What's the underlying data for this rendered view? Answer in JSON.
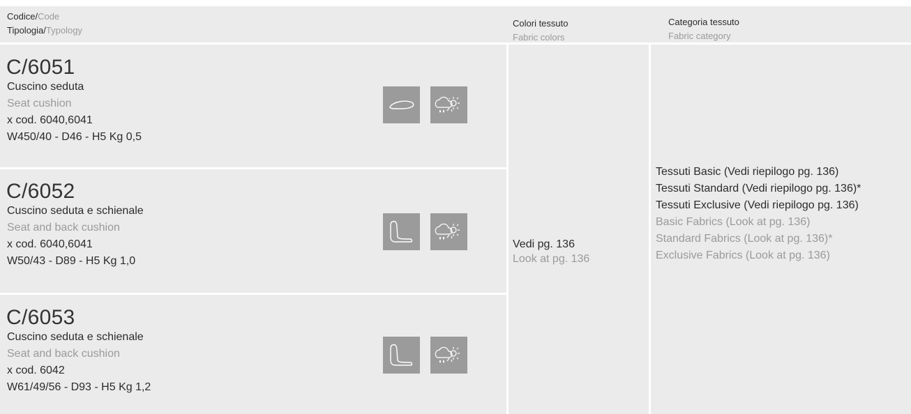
{
  "header": {
    "code_it": "Codice/",
    "code_en": "Code",
    "typology_it": "Tipologia/",
    "typology_en": "Typology",
    "colors_it": "Colori tessuto",
    "colors_en": "Fabric colors",
    "category_it": "Categoria tessuto",
    "category_en": "Fabric category"
  },
  "products": [
    {
      "code": "C/6051",
      "name_it": "Cuscino seduta",
      "name_en": "Seat cushion",
      "compat": "x cod. 6040,6041",
      "dims": "W450/40 - D46 - H5  Kg 0,5",
      "icons": [
        "seat-cushion-icon",
        "outdoor-weather-icon"
      ]
    },
    {
      "code": "C/6052",
      "name_it": "Cuscino seduta e schienale",
      "name_en": "Seat and back cushion",
      "compat": "x cod. 6040,6041",
      "dims": "W50/43 - D89 - H5  Kg 1,0",
      "icons": [
        "seat-back-cushion-icon",
        "outdoor-weather-icon"
      ]
    },
    {
      "code": "C/6053",
      "name_it": "Cuscino seduta e schienale",
      "name_en": "Seat and back cushion",
      "compat": "x cod. 6042",
      "dims": "W61/49/56 - D93 - H5  Kg 1,2",
      "icons": [
        "seat-back-cushion-icon",
        "outdoor-weather-icon"
      ]
    }
  ],
  "fabric_colors": {
    "it": "Vedi pg. 136",
    "en": "Look at pg. 136"
  },
  "fabric_category": {
    "it": [
      "Tessuti Basic (Vedi riepilogo pg. 136)",
      "Tessuti Standard (Vedi riepilogo pg. 136)*",
      "Tessuti Exclusive (Vedi riepilogo pg. 136)"
    ],
    "en": [
      "Basic Fabrics (Look at pg. 136)",
      "Standard Fabrics (Look at pg. 136)*",
      "Exclusive Fabrics (Look at pg. 136)"
    ]
  },
  "colors": {
    "cell_bg": "#ebebeb",
    "icon_bg": "#9b9b9b",
    "text_dark": "#2b2b2b",
    "text_light": "#9a9a9a"
  }
}
